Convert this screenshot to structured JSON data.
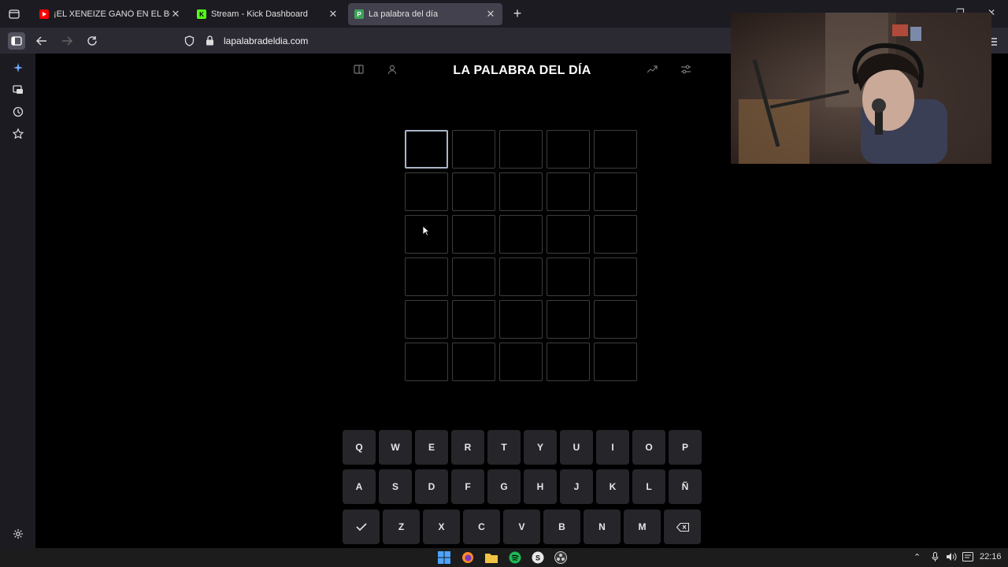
{
  "browser": {
    "tabs": [
      {
        "title": "¡EL XENEIZE GANÓ EN EL BOSQ",
        "favicon": "youtube-icon",
        "active": false
      },
      {
        "title": "Stream - Kick Dashboard",
        "favicon": "kick-icon",
        "active": false
      },
      {
        "title": "La palabra del día",
        "favicon": "p-icon",
        "active": true
      }
    ],
    "url": "lapalabradeldia.com"
  },
  "page": {
    "title": "LA PALABRA DEL DÍA",
    "grid": {
      "rows": [
        [
          "",
          "",
          "",
          "",
          ""
        ],
        [
          "",
          "",
          "",
          "",
          ""
        ],
        [
          "",
          "",
          "",
          "",
          ""
        ],
        [
          "",
          "",
          "",
          "",
          ""
        ],
        [
          "",
          "",
          "",
          "",
          ""
        ],
        [
          "",
          "",
          "",
          "",
          ""
        ]
      ]
    },
    "keyboard": {
      "row1": [
        "Q",
        "W",
        "E",
        "R",
        "T",
        "Y",
        "U",
        "I",
        "O",
        "P"
      ],
      "row2": [
        "A",
        "S",
        "D",
        "F",
        "G",
        "H",
        "J",
        "K",
        "L",
        "Ñ"
      ],
      "row3": [
        "Z",
        "X",
        "C",
        "V",
        "B",
        "N",
        "M"
      ]
    }
  },
  "taskbar": {
    "time": "22:16"
  },
  "colors": {
    "background": "#000000",
    "cell_border": "#3d3d3d",
    "active_cell_border": "#aab6c8",
    "key_background": "#26262a",
    "youtube": "#ff0000",
    "kick": "#53fc18",
    "p_favicon": "#3ca35a"
  }
}
